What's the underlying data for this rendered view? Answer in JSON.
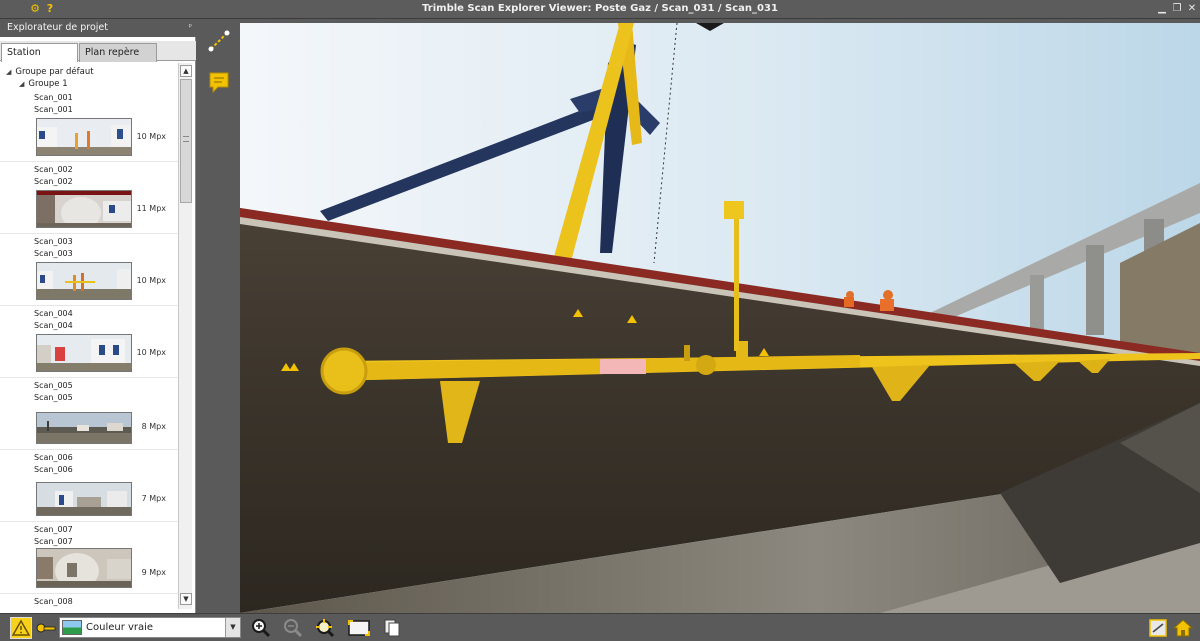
{
  "window": {
    "title": "Trimble Scan Explorer Viewer: Poste Gaz / Scan_031 / Scan_031",
    "settings_icon": "gear-icon",
    "help_label": "?"
  },
  "panel": {
    "title": "Explorateur de projet",
    "tabs": [
      {
        "label": "Station",
        "active": true
      },
      {
        "label": "Plan repère",
        "active": false
      }
    ],
    "tree": {
      "root_label": "Groupe par défaut",
      "group_label": "Groupe 1",
      "scans": [
        {
          "name": "Scan_001",
          "sub": "Scan_001",
          "resolution": "10 Mpx"
        },
        {
          "name": "Scan_002",
          "sub": "Scan_002",
          "resolution": "11 Mpx"
        },
        {
          "name": "Scan_003",
          "sub": "Scan_003",
          "resolution": "10 Mpx"
        },
        {
          "name": "Scan_004",
          "sub": "Scan_004",
          "resolution": "10 Mpx"
        },
        {
          "name": "Scan_005",
          "sub": "Scan_005",
          "resolution": "8 Mpx"
        },
        {
          "name": "Scan_006",
          "sub": "Scan_006",
          "resolution": "7 Mpx"
        },
        {
          "name": "Scan_007",
          "sub": "Scan_007",
          "resolution": "9 Mpx"
        },
        {
          "name": "Scan_008",
          "sub": "",
          "resolution": ""
        }
      ]
    }
  },
  "sidebar_tools": [
    "measure-icon",
    "note-icon"
  ],
  "bottom": {
    "color_mode": "Couleur vraie",
    "tools": [
      "zoom-in-icon",
      "zoom-out-icon",
      "zoom-target-icon",
      "fit-view-icon",
      "copy-icon"
    ]
  },
  "colors": {
    "accent_yellow": "#f2c200",
    "chrome_gray": "#5a5a5a"
  }
}
